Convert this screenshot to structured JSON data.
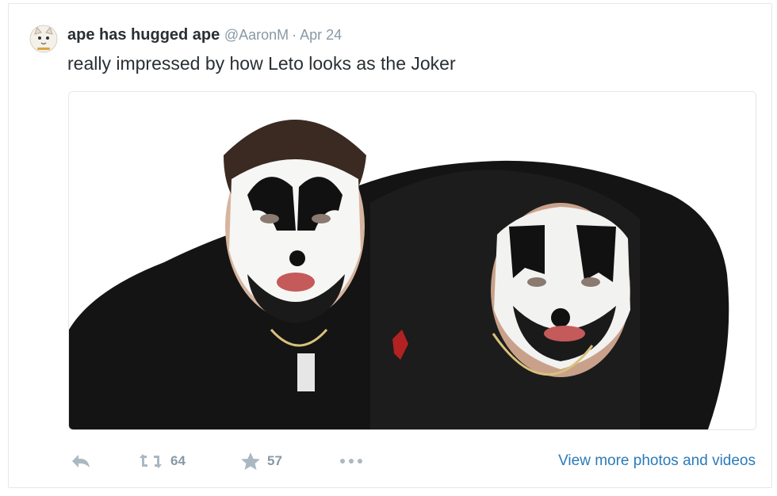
{
  "tweet": {
    "display_name": "ape has hugged ape",
    "handle": "@AaronM",
    "separator": "·",
    "date": "Apr 24",
    "text": "really impressed by how Leto looks as the Joker"
  },
  "media": {
    "alt": "Two men in black and white face paint wearing black clothing and chains"
  },
  "actions": {
    "reply_icon": "reply-icon",
    "retweet_icon": "retweet-icon",
    "retweet_count": "64",
    "favorite_icon": "star-icon",
    "favorite_count": "57",
    "more_icon": "more-dots-icon",
    "view_more": "View more photos and videos"
  },
  "colors": {
    "name": "#292f33",
    "meta": "#8899a6",
    "action_icon": "#aab8c2",
    "link": "#2b7bb9",
    "border": "#e1e8ed"
  }
}
